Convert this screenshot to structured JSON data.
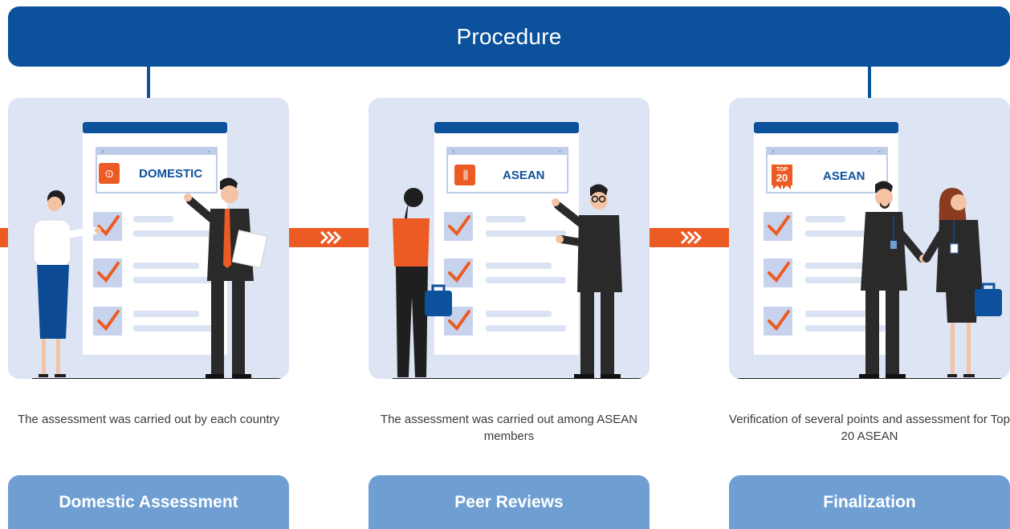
{
  "banner": {
    "title": "Procedure"
  },
  "colors": {
    "brand_blue": "#0b519b",
    "card_bg": "#dde4f3",
    "accent_orange": "#ec5b24",
    "step_button": "#6f9fd2"
  },
  "steps": [
    {
      "badge": "DOMESTIC",
      "badge_icon": "location-pin-icon",
      "description": "The assessment was carried out by each country",
      "button": "Domestic Assessment"
    },
    {
      "badge": "ASEAN",
      "badge_icon": "asean-emblem-icon",
      "description": "The assessment was carried out among ASEAN members",
      "button": "Peer Reviews"
    },
    {
      "badge": "ASEAN",
      "badge_icon": "top20-ribbon-icon",
      "badge_icon_text": {
        "top": "TOP",
        "number": "20"
      },
      "description": "Verification of several points and assessment for Top 20 ASEAN",
      "button": "Finalization"
    }
  ]
}
